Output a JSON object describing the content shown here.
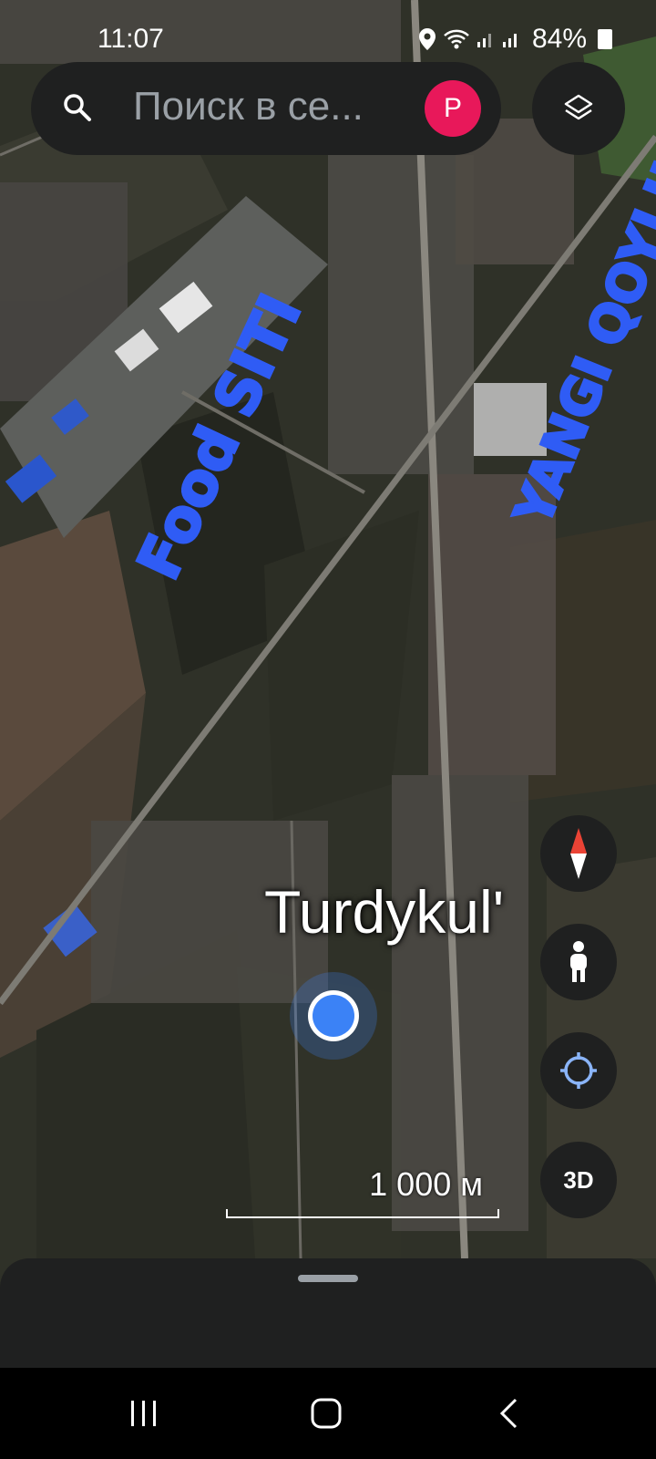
{
  "status_bar": {
    "time": "11:07",
    "battery": "84%"
  },
  "search": {
    "placeholder": "Поиск в се...",
    "avatar_letter": "P"
  },
  "map": {
    "place_label": "Turdykul'",
    "scale_label": "1 000 м",
    "annotations": [
      {
        "text": "Food SITI"
      },
      {
        "text": "YANGI QOYLIK"
      }
    ]
  },
  "controls": {
    "three_d_label": "3D"
  },
  "colors": {
    "annotation": "#2f5cf5",
    "location_dot": "#3b82f6",
    "avatar": "#e8185a"
  }
}
